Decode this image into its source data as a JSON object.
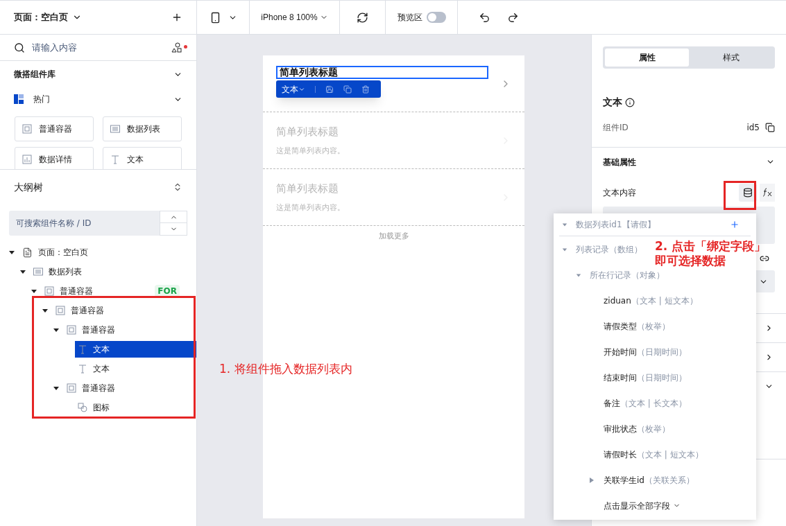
{
  "topbar": {
    "page": "页面：空白页",
    "device": "iPhone 8 100%",
    "preview": {
      "label": "预览区",
      "on": false
    }
  },
  "sidebar": {
    "search": {
      "placeholder": "请输入内容"
    },
    "library": "微搭组件库",
    "group": "热门",
    "components": [
      {
        "label": "普通容器",
        "kind": "container"
      },
      {
        "label": "数据列表",
        "kind": "list"
      },
      {
        "label": "数据详情",
        "kind": "detail"
      },
      {
        "label": "文本",
        "kind": "text"
      }
    ],
    "outline": {
      "title": "大纲树",
      "search": {
        "placeholder": "可搜索组件名称 / ID"
      },
      "tree": [
        {
          "label": "页面：空白页",
          "kind": "page",
          "expanded": true,
          "selected": false,
          "children": [
            {
              "label": "数据列表",
              "kind": "list",
              "expanded": true,
              "selected": false,
              "children": [
                {
                  "label": "普通容器",
                  "kind": "container",
                  "expanded": true,
                  "selected": false,
                  "badge": "FOR",
                  "children": [
                    {
                      "label": "普通容器",
                      "kind": "container",
                      "expanded": true,
                      "selected": false,
                      "children": [
                        {
                          "label": "普通容器",
                          "kind": "container",
                          "expanded": true,
                          "selected": false,
                          "children": [
                            {
                              "label": "文本",
                              "kind": "text",
                              "selected": true
                            },
                            {
                              "label": "文本",
                              "kind": "text",
                              "selected": false
                            }
                          ]
                        },
                        {
                          "label": "普通容器",
                          "kind": "container",
                          "expanded": true,
                          "selected": false,
                          "children": [
                            {
                              "label": "图标",
                              "kind": "icon",
                              "selected": false
                            }
                          ]
                        }
                      ]
                    }
                  ]
                }
              ]
            }
          ]
        }
      ]
    }
  },
  "canvas": {
    "items": [
      {
        "title": "简单列表标题",
        "faded": false
      },
      {
        "title": "简单列表标题",
        "subtitle": "这是简单列表内容。",
        "faded": true
      },
      {
        "title": "简单列表标题",
        "subtitle": "这是简单列表内容。",
        "faded": true
      }
    ],
    "load_more": "加载更多",
    "toolbar": {
      "label": "文本"
    }
  },
  "panel": {
    "tabs": [
      {
        "label": "属性",
        "selected": true
      },
      {
        "label": "样式",
        "selected": false
      }
    ],
    "component": "文本",
    "id_label": "组件ID",
    "id_value": "id5",
    "section": "基础属性",
    "field_label": "文本内容"
  },
  "popup": {
    "source": "数据列表id1【请假】",
    "records": "列表记录（数组）",
    "row": "所在行记录（对象）",
    "fields": [
      {
        "name": "ziduan",
        "type": "（文本 | 短文本）",
        "expandable": false
      },
      {
        "name": "请假类型",
        "type": "（枚举）",
        "expandable": false
      },
      {
        "name": "开始时间",
        "type": "（日期时间）",
        "expandable": false
      },
      {
        "name": "结束时间",
        "type": "（日期时间）",
        "expandable": false
      },
      {
        "name": "备注",
        "type": "（文本 | 长文本）",
        "expandable": false
      },
      {
        "name": "审批状态",
        "type": "（枚举）",
        "expandable": false
      },
      {
        "name": "请假时长",
        "type": "（文本 | 短文本）",
        "expandable": false
      },
      {
        "name": "关联学生id",
        "type": "（关联关系）",
        "expandable": true
      }
    ],
    "more": "点击显示全部字段"
  },
  "annotations": [
    "1. 将组件拖入数据列表内",
    "2. 点击「绑定字段」",
    "即可选择数据"
  ]
}
